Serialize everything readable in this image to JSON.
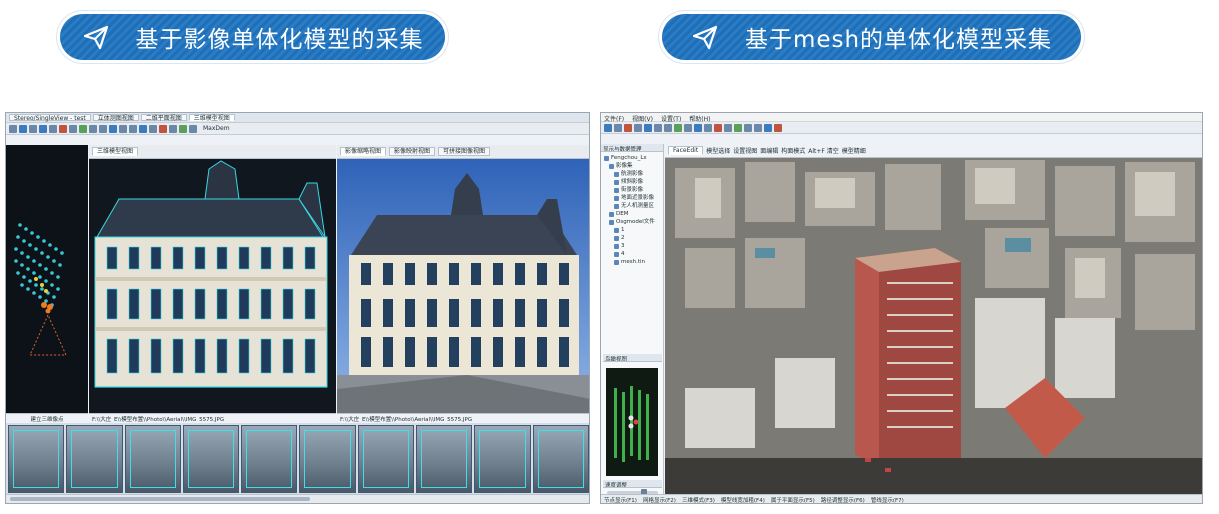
{
  "headlines": {
    "left": "基于影像单体化模型的采集",
    "right": "基于mesh的单体化模型采集"
  },
  "left_app": {
    "tabs": [
      "Stereo/SingleView - test",
      "立体测图视图",
      "二维平面视图",
      "三维模型视图"
    ],
    "model_pane_tab": "三维模型视图",
    "photo_pane_tabs": [
      "影像缩略视图",
      "影像映射视图",
      "可拼接图像视图"
    ],
    "status_points": "建立三维像点",
    "status_model": "F:\\\\大庄_E\\\\模型布置\\\\Photo\\\\Aerial\\\\IMG_5575.JPG",
    "status_photo": "F:\\\\大庄_E\\\\模型布置\\\\Photo\\\\Aerial\\\\IMG_5575.JPG",
    "toolbar_label": "MaxDem"
  },
  "right_app": {
    "menu": [
      "文件(F)",
      "视图(V)",
      "设置(T)",
      "帮助(H)"
    ],
    "panel_title": "显示与数据管理",
    "tree": [
      {
        "level": 0,
        "label": "Fengchou_Lx"
      },
      {
        "level": 1,
        "label": "影像集"
      },
      {
        "level": 2,
        "label": "航测影像"
      },
      {
        "level": 2,
        "label": "倾斜影像"
      },
      {
        "level": 2,
        "label": "街景影像"
      },
      {
        "level": 2,
        "label": "地面近景影像"
      },
      {
        "level": 2,
        "label": "无人机测量区"
      },
      {
        "level": 1,
        "label": "DEM"
      },
      {
        "level": 1,
        "label": "Osgmodel文件"
      },
      {
        "level": 2,
        "label": "1"
      },
      {
        "level": 2,
        "label": "2"
      },
      {
        "level": 2,
        "label": "3"
      },
      {
        "level": 2,
        "label": "4"
      },
      {
        "level": 2,
        "label": "mesh.tin"
      }
    ],
    "view_tab": "FaceEdit",
    "view_toolbar": [
      "模型选择",
      "设置视图",
      "面编辑",
      "构面模式",
      "Alt+F 清空",
      "模型精细"
    ],
    "mini_title": "鸟瞰视图",
    "speed_label": "速度调整",
    "statusbar": [
      "节点显示(F1)",
      "网格显示(F2)",
      "三维模式(F3)",
      "模型线宽加粗(F4)",
      "属于平面显示(F5)",
      "路径调整显示(F6)",
      "管线显示(F7)"
    ]
  }
}
